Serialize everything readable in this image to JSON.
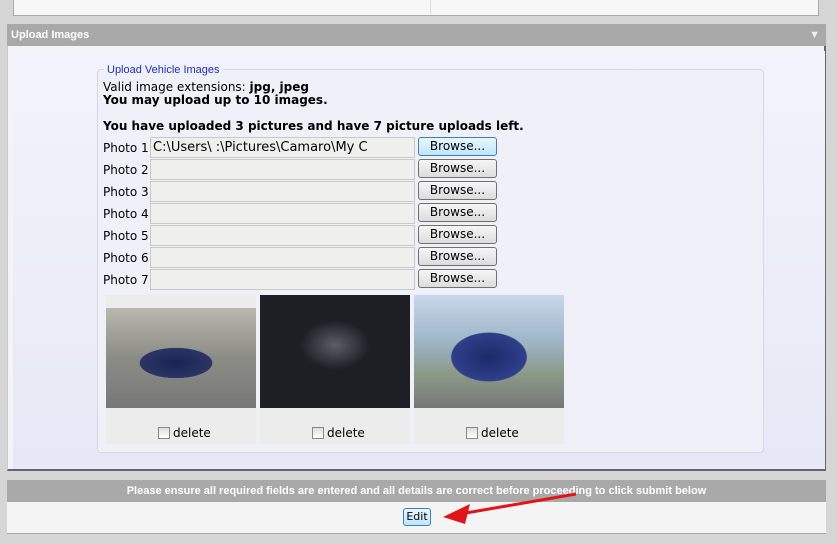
{
  "section": {
    "title": "Upload Images",
    "collapse_icon": "triangle-down-icon"
  },
  "fieldset": {
    "legend": "Upload Vehicle Images",
    "extensions_label": "Valid image extensions: ",
    "extensions_value": "jpg, jpeg",
    "limit_text": "You may upload up to 10 images.",
    "status_text": "You have uploaded 3 pictures and have 7 picture uploads left."
  },
  "photos": [
    {
      "label": "Photo 1",
      "value": "C:\\Users\\                    :\\Pictures\\Camaro\\My C",
      "browse": "Browse..."
    },
    {
      "label": "Photo 2",
      "value": "",
      "browse": "Browse..."
    },
    {
      "label": "Photo 3",
      "value": "",
      "browse": "Browse..."
    },
    {
      "label": "Photo 4",
      "value": "",
      "browse": "Browse..."
    },
    {
      "label": "Photo 5",
      "value": "",
      "browse": "Browse..."
    },
    {
      "label": "Photo 6",
      "value": "",
      "browse": "Browse..."
    },
    {
      "label": "Photo 7",
      "value": "",
      "browse": "Browse..."
    }
  ],
  "uploaded": [
    {
      "delete_label": "delete"
    },
    {
      "delete_label": "delete"
    },
    {
      "delete_label": "delete"
    }
  ],
  "notice": "Please ensure all required fields are entered and all details are correct before proceeding to click submit below",
  "edit_button": "Edit",
  "annotation_color": "#e0141a"
}
